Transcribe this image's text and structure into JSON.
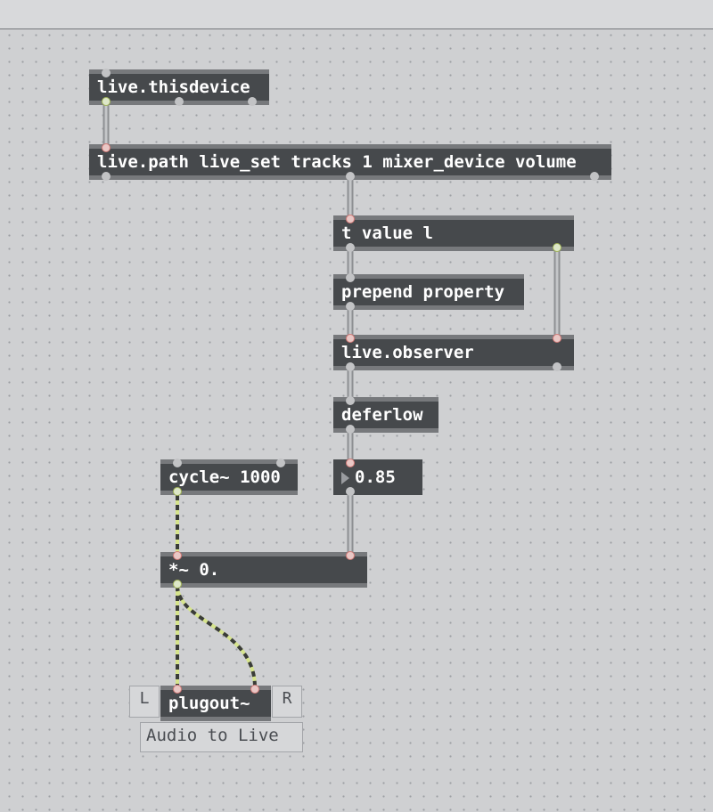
{
  "objects": {
    "thisdevice": "live.thisdevice",
    "livepath": "live.path live_set tracks 1 mixer_device volume",
    "trigger": "t value l",
    "prepend": "prepend property",
    "observer": "live.observer",
    "deferlow": "deferlow",
    "number_value": "0.85",
    "cycle": "cycle~ 1000",
    "multiply": "*~ 0.",
    "plugout": "plugout~"
  },
  "channel_boxes": {
    "left": "L",
    "right": "R"
  },
  "comment": "Audio to Live",
  "colors": {
    "canvas": "#cfd0d2",
    "object_body": "#46494c",
    "object_bar": "#77797c",
    "control_wire": "#9fa1a4",
    "signal_wire_dash": "#3a3c38",
    "signal_wire_gap": "#d6e48c",
    "inlet_outlet_highlight": "#d47b78",
    "signal_outlet": "#a3b659"
  }
}
